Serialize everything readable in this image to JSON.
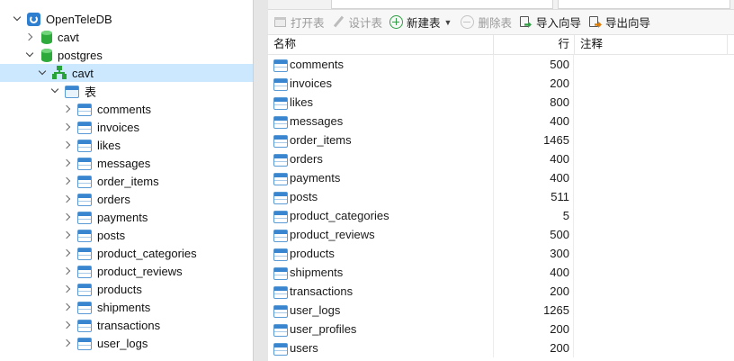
{
  "tree": {
    "items": [
      {
        "label": "OpenTeleDB",
        "kind": "connection",
        "chevron": "down"
      },
      {
        "label": "cavt",
        "kind": "database",
        "chevron": "right"
      },
      {
        "label": "postgres",
        "kind": "database",
        "chevron": "down"
      },
      {
        "label": "cavt",
        "kind": "schema",
        "chevron": "down",
        "selected": true
      },
      {
        "label": "表",
        "kind": "table-folder",
        "chevron": "down"
      },
      {
        "label": "comments",
        "kind": "table",
        "chevron": "right"
      },
      {
        "label": "invoices",
        "kind": "table",
        "chevron": "right"
      },
      {
        "label": "likes",
        "kind": "table",
        "chevron": "right"
      },
      {
        "label": "messages",
        "kind": "table",
        "chevron": "right"
      },
      {
        "label": "order_items",
        "kind": "table",
        "chevron": "right"
      },
      {
        "label": "orders",
        "kind": "table",
        "chevron": "right"
      },
      {
        "label": "payments",
        "kind": "table",
        "chevron": "right"
      },
      {
        "label": "posts",
        "kind": "table",
        "chevron": "right"
      },
      {
        "label": "product_categories",
        "kind": "table",
        "chevron": "right"
      },
      {
        "label": "product_reviews",
        "kind": "table",
        "chevron": "right"
      },
      {
        "label": "products",
        "kind": "table",
        "chevron": "right"
      },
      {
        "label": "shipments",
        "kind": "table",
        "chevron": "right"
      },
      {
        "label": "transactions",
        "kind": "table",
        "chevron": "right"
      },
      {
        "label": "user_logs",
        "kind": "table",
        "chevron": "right"
      }
    ]
  },
  "toolbar": {
    "open_label": "打开表",
    "design_label": "设计表",
    "new_label": "新建表",
    "delete_label": "删除表",
    "import_label": "导入向导",
    "export_label": "导出向导"
  },
  "grid": {
    "headers": {
      "name": "名称",
      "rows": "行",
      "comment": "注释"
    },
    "rows": [
      {
        "name": "comments",
        "rows": "500"
      },
      {
        "name": "invoices",
        "rows": "200"
      },
      {
        "name": "likes",
        "rows": "800"
      },
      {
        "name": "messages",
        "rows": "400"
      },
      {
        "name": "order_items",
        "rows": "1465"
      },
      {
        "name": "orders",
        "rows": "400"
      },
      {
        "name": "payments",
        "rows": "400"
      },
      {
        "name": "posts",
        "rows": "511"
      },
      {
        "name": "product_categories",
        "rows": "5"
      },
      {
        "name": "product_reviews",
        "rows": "500"
      },
      {
        "name": "products",
        "rows": "300"
      },
      {
        "name": "shipments",
        "rows": "400"
      },
      {
        "name": "transactions",
        "rows": "200"
      },
      {
        "name": "user_logs",
        "rows": "1265"
      },
      {
        "name": "user_profiles",
        "rows": "200"
      },
      {
        "name": "users",
        "rows": "200"
      }
    ]
  },
  "colors": {
    "selection": "#cce8ff",
    "accent": "#3a85cf",
    "db_green": "#2eaa3d"
  }
}
